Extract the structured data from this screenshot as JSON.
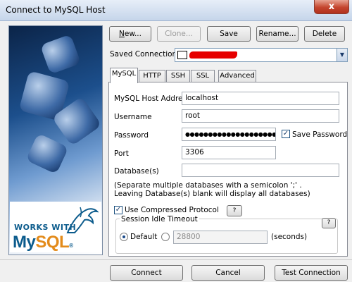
{
  "window": {
    "title": "Connect to MySQL Host",
    "close_glyph": "x"
  },
  "sidebar": {
    "brand_works": "WORKS WITH",
    "brand_my": "My",
    "brand_sql": "SQL",
    "brand_tm": "®"
  },
  "toolbar": {
    "new": "New...",
    "clone": "Clone...",
    "save": "Save",
    "rename": "Rename...",
    "delete": "Delete"
  },
  "saved": {
    "label": "Saved Connections",
    "dropdown_icon": "chevron-down-icon"
  },
  "tabs": [
    {
      "label": "MySQL",
      "active": true
    },
    {
      "label": "HTTP",
      "active": false
    },
    {
      "label": "SSH",
      "active": false
    },
    {
      "label": "SSL",
      "active": false
    },
    {
      "label": "Advanced",
      "active": false
    }
  ],
  "form": {
    "host_label": "MySQL Host Address",
    "host_value": "localhost",
    "user_label": "Username",
    "user_value": "root",
    "password_label": "Password",
    "password_value": "●●●●●●●●●●●●●●●●●●●●●",
    "save_password_label": "Save Password",
    "save_password_checked": true,
    "port_label": "Port",
    "port_value": "3306",
    "db_label": "Database(s)",
    "db_value": "",
    "db_hint_1": "(Separate multiple databases with a semicolon ';' .",
    "db_hint_2": "Leaving Database(s) blank will display all databases)",
    "compress_label": "Use Compressed Protocol",
    "compress_checked": true,
    "help_label": "?",
    "idle_group_label": "Session Idle Timeout",
    "idle_help_label": "?",
    "default_label": "Default",
    "default_selected": true,
    "idle_value": "28800",
    "seconds_label": "(seconds)"
  },
  "footer": {
    "connect": "Connect",
    "cancel": "Cancel",
    "test": "Test Connection"
  }
}
